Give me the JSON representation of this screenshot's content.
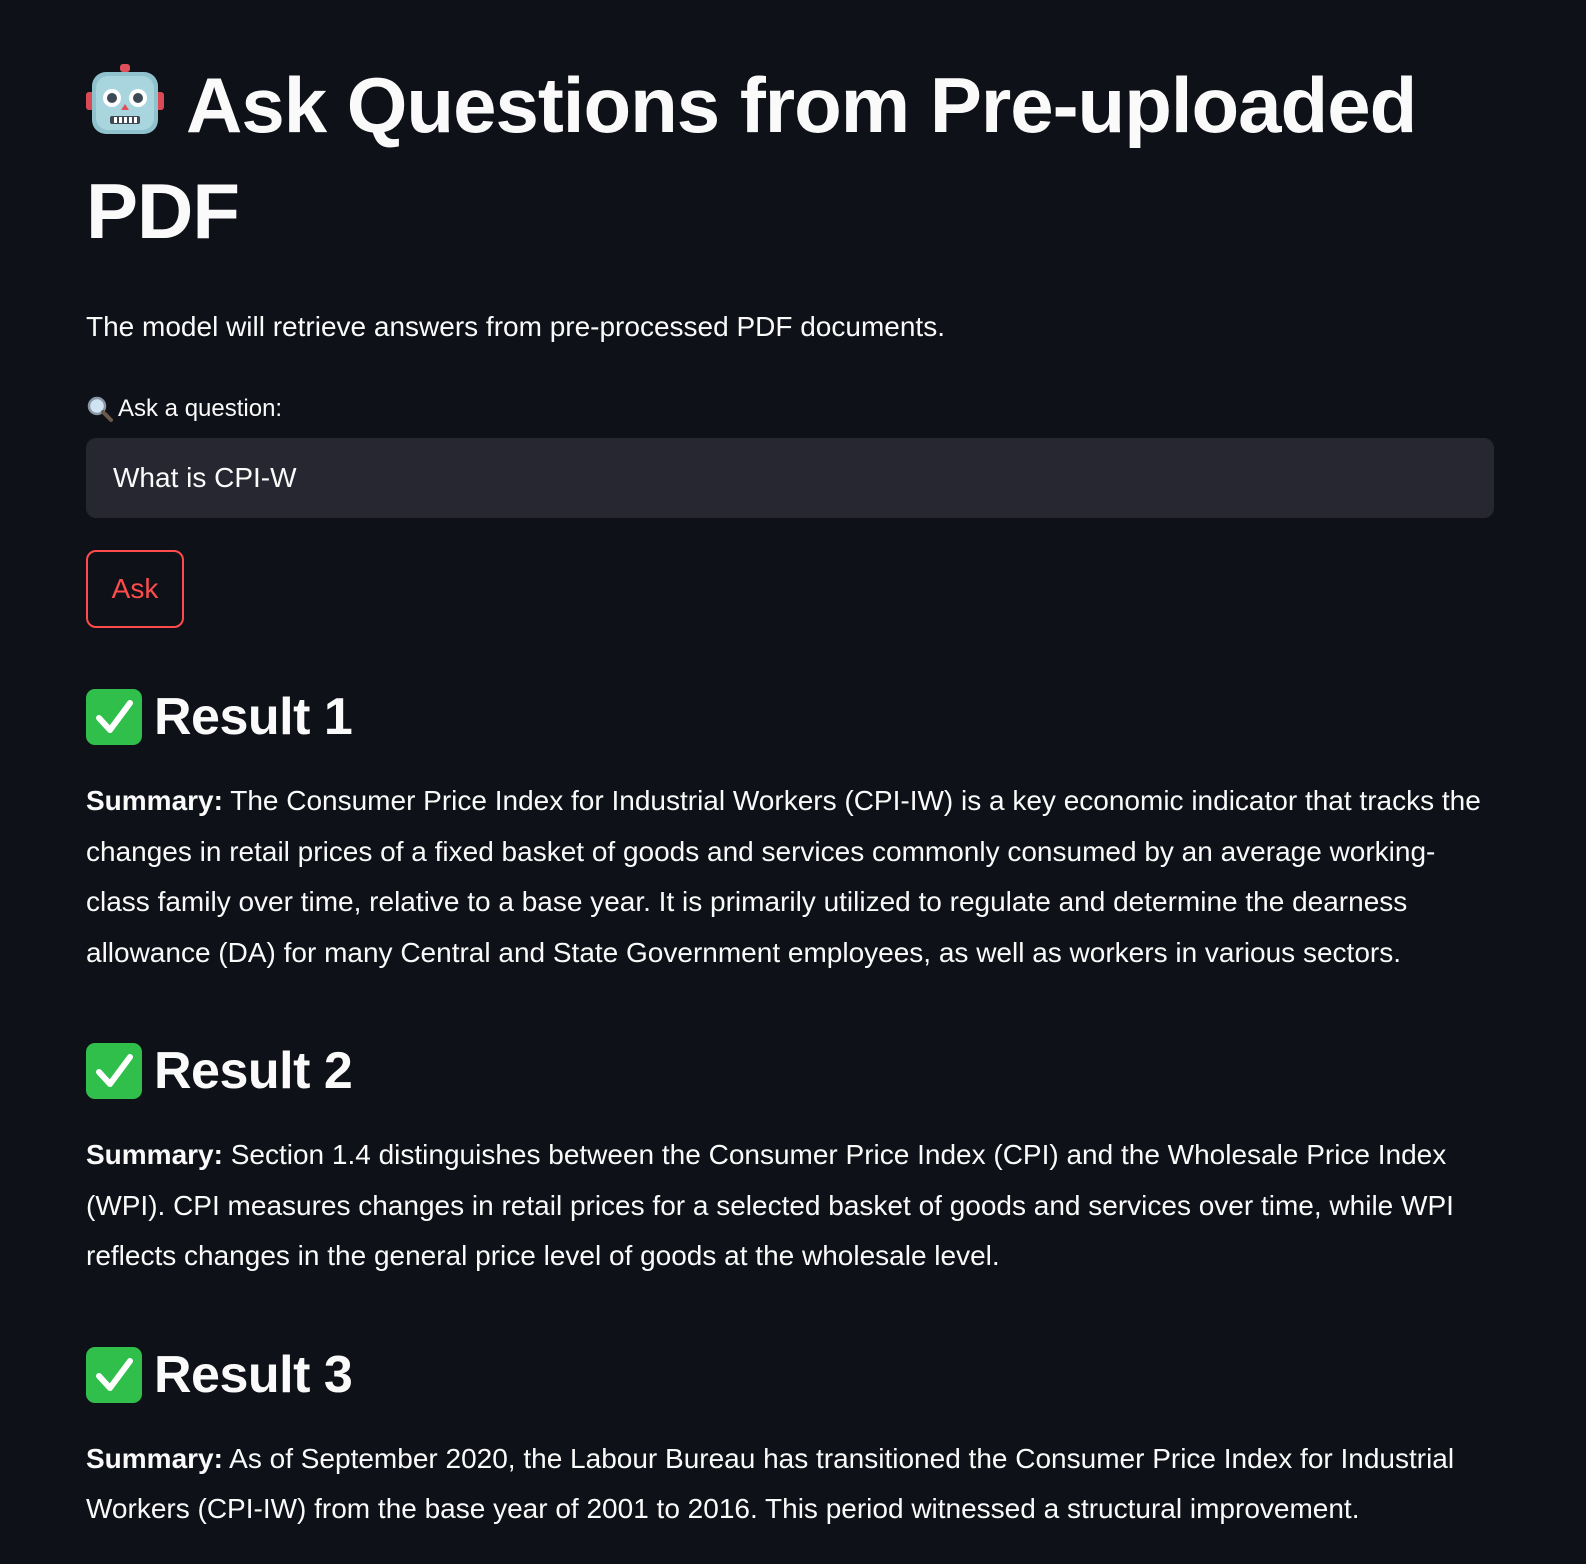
{
  "page": {
    "title": "Ask Questions from Pre-uploaded PDF",
    "title_emoji": "robot-face-icon",
    "description": "The model will retrieve answers from pre-processed PDF documents."
  },
  "question": {
    "label": "Ask a question:",
    "label_icon": "magnifying-glass-icon",
    "value": "What is CPI-W"
  },
  "ask_button": {
    "label": "Ask"
  },
  "results": [
    {
      "heading": "Result 1",
      "summary_label": "Summary:",
      "summary": "The Consumer Price Index for Industrial Workers (CPI-IW) is a key economic indicator that tracks the changes in retail prices of a fixed basket of goods and services commonly consumed by an average working-class family over time, relative to a base year. It is primarily utilized to regulate and determine the dearness allowance (DA) for many Central and State Government employees, as well as workers in various sectors."
    },
    {
      "heading": "Result 2",
      "summary_label": "Summary:",
      "summary": "Section 1.4 distinguishes between the Consumer Price Index (CPI) and the Wholesale Price Index (WPI). CPI measures changes in retail prices for a selected basket of goods and services over time, while WPI reflects changes in the general price level of goods at the wholesale level."
    },
    {
      "heading": "Result 3",
      "summary_label": "Summary:",
      "summary": "As of September 2020, the Labour Bureau has transitioned the Consumer Price Index for Industrial Workers (CPI-IW) from the base year of 2001 to 2016. This period witnessed a structural improvement."
    }
  ],
  "colors": {
    "background": "#0e1117",
    "input_background": "#262730",
    "accent": "#ff4b4b",
    "text": "#fafafa",
    "check_green": "#2fbf4a"
  }
}
